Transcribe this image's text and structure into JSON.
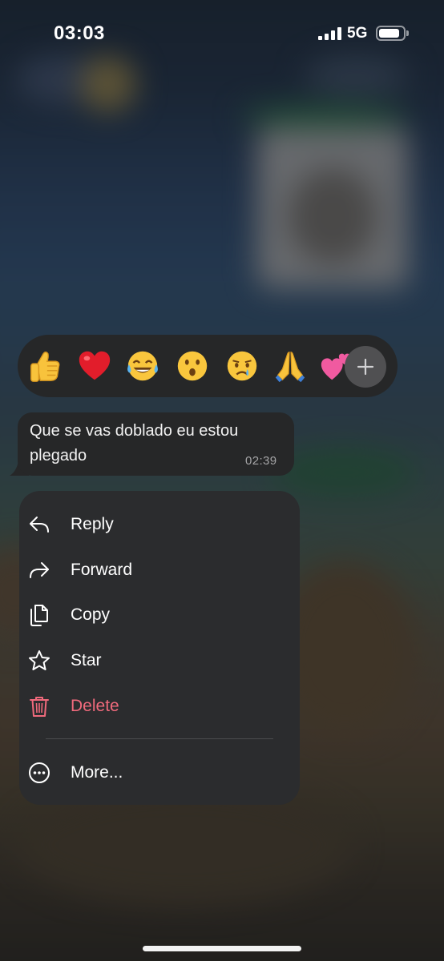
{
  "status_bar": {
    "time": "03:03",
    "network": "5G",
    "signal_bars": 4,
    "battery_level": 0.85
  },
  "reactions": {
    "emojis": [
      {
        "name": "thumbs-up-icon"
      },
      {
        "name": "red-heart-icon"
      },
      {
        "name": "tears-of-joy-icon"
      },
      {
        "name": "surprised-face-icon"
      },
      {
        "name": "crying-face-icon"
      },
      {
        "name": "folded-hands-icon"
      },
      {
        "name": "two-hearts-icon"
      }
    ],
    "more_icon": "plus-icon"
  },
  "message": {
    "text": "Que se vas doblado eu estou plegado",
    "time": "02:39"
  },
  "menu": {
    "items": [
      {
        "label": "Reply",
        "icon": "reply-icon"
      },
      {
        "label": "Forward",
        "icon": "forward-icon"
      },
      {
        "label": "Copy",
        "icon": "copy-icon"
      },
      {
        "label": "Star",
        "icon": "star-icon"
      },
      {
        "label": "Delete",
        "icon": "trash-icon",
        "color": "#f06a7c"
      }
    ],
    "more": {
      "label": "More...",
      "icon": "more-icon"
    }
  },
  "colors": {
    "menu_background": "#2b2c2e",
    "bubble_background": "#262728",
    "delete_color": "#f06a7c"
  }
}
